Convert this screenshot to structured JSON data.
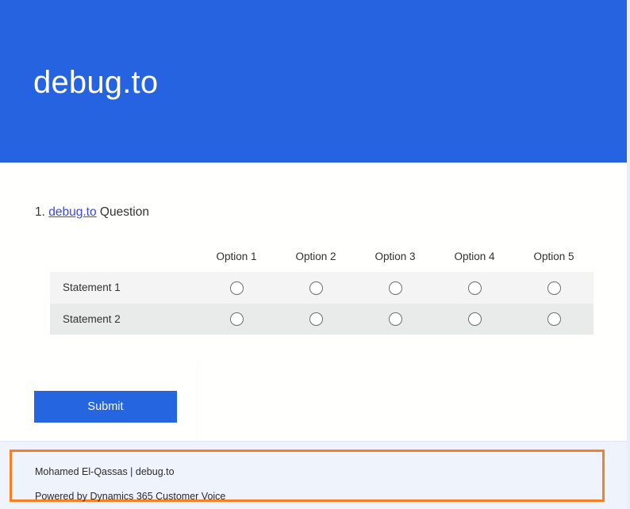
{
  "banner": {
    "title": "debug.to",
    "background_color": "#2563e0"
  },
  "question": {
    "number": "1.",
    "link_text": "debug.to",
    "rest_text": " Question"
  },
  "matrix": {
    "row_header_label": "",
    "options": [
      "Option 1",
      "Option 2",
      "Option 3",
      "Option 4",
      "Option 5"
    ],
    "statements": [
      "Statement 1",
      "Statement 2"
    ]
  },
  "actions": {
    "submit_label": "Submit",
    "submit_color": "#2565e0"
  },
  "footer": {
    "line1": "Mohamed El-Qassas | debug.to",
    "line2": "Powered by Dynamics 365 Customer Voice",
    "highlight_color": "#f58025",
    "background_color": "#eff3fc"
  }
}
